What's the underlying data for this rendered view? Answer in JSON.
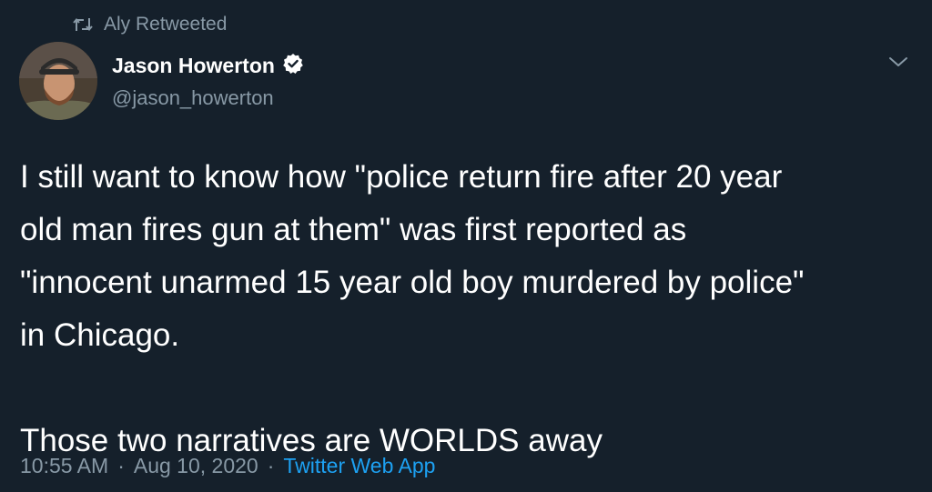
{
  "retweet": {
    "icon": "retweet-icon",
    "label": "Aly Retweeted"
  },
  "author": {
    "display_name": "Jason Howerton",
    "handle": "@jason_howerton",
    "verified": true,
    "verified_icon": "verified-badge-icon"
  },
  "menu": {
    "icon": "chevron-down-icon"
  },
  "tweet": {
    "lines": [
      "I still want to know how \"police return fire after 20 year",
      "old man fires gun at them\" was first reported as",
      "\"innocent unarmed 15 year old boy murdered by police\"",
      "in Chicago."
    ],
    "second_paragraph": "Those two narratives are WORLDS away"
  },
  "meta": {
    "time": "10:55 AM",
    "separator": "·",
    "date": "Aug 10, 2020",
    "source": "Twitter Web App"
  },
  "colors": {
    "background": "#15202b",
    "secondary_text": "#8899a6",
    "link": "#1da1f2"
  }
}
